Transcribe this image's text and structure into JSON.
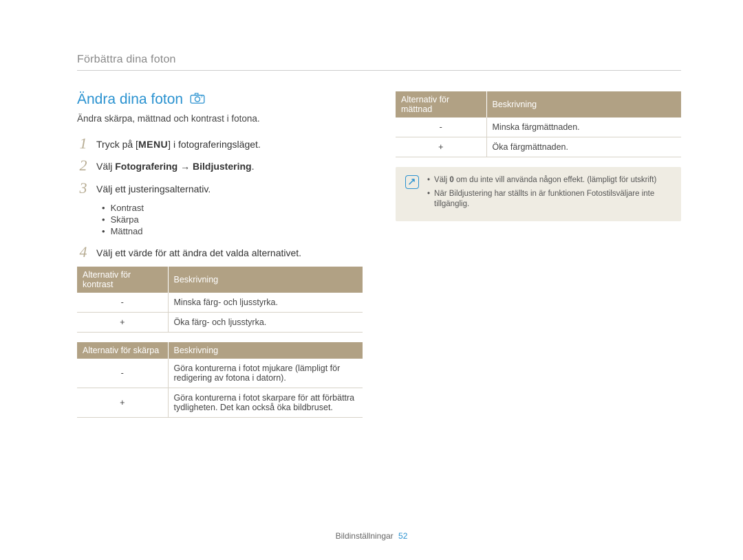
{
  "top_heading": "Förbättra dina foton",
  "section_title": "Ändra dina foton",
  "intro": "Ändra skärpa, mättnad och kontrast i fotona.",
  "steps": {
    "s1_pre": "Tryck på [",
    "s1_menu": "MENU",
    "s1_post": "] i fotograferingsläget.",
    "s2_pre": "Välj ",
    "s2_bold": "Fotografering → Bildjustering",
    "s2_post": ".",
    "s3": "Välj ett justeringsalternativ.",
    "s4": "Välj ett värde för att ändra det valda alternativet."
  },
  "bullets": [
    "Kontrast",
    "Skärpa",
    "Mättnad"
  ],
  "table_kontrast": {
    "h1": "Alternativ för kontrast",
    "h2": "Beskrivning",
    "rows": [
      {
        "opt": "-",
        "desc": "Minska färg- och ljusstyrka."
      },
      {
        "opt": "+",
        "desc": "Öka färg- och ljusstyrka."
      }
    ]
  },
  "table_skarpa": {
    "h1": "Alternativ för skärpa",
    "h2": "Beskrivning",
    "rows": [
      {
        "opt": "-",
        "desc": "Göra konturerna i fotot mjukare (lämpligt för redigering av fotona i datorn)."
      },
      {
        "opt": "+",
        "desc": "Göra konturerna i fotot skarpare för att förbättra tydligheten. Det kan också öka bildbruset."
      }
    ]
  },
  "table_mattnad": {
    "h1": "Alternativ för mättnad",
    "h2": "Beskrivning",
    "rows": [
      {
        "opt": "-",
        "desc": "Minska färgmättnaden."
      },
      {
        "opt": "+",
        "desc": "Öka färgmättnaden."
      }
    ]
  },
  "info": {
    "line1_pre": "Välj ",
    "line1_bold": "0",
    "line1_post": " om du inte vill använda någon effekt. (lämpligt för utskrift)",
    "line2": "När Bildjustering har ställts in är funktionen Fotostilsväljare inte tillgänglig."
  },
  "footer": {
    "label": "Bildinställningar",
    "page": "52"
  }
}
